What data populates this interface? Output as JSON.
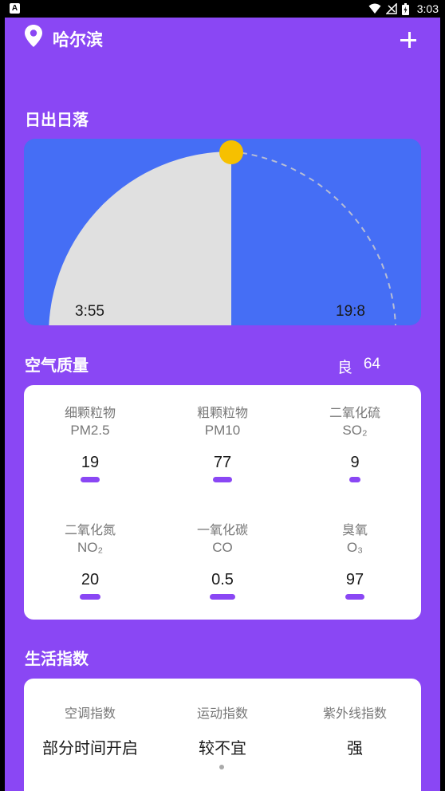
{
  "status_bar": {
    "app_icon_label": "A",
    "time": "3:03"
  },
  "header": {
    "city": "哈尔滨",
    "add_icon": "plus-icon",
    "location_icon": "location-pin-icon"
  },
  "sunrise_sunset": {
    "title": "日出日落",
    "sunrise": "3:55",
    "sunset": "19:8",
    "colors": {
      "sky": "#456ef5",
      "elapsed": "#e0e0e0",
      "sun": "#f6c000"
    }
  },
  "air_quality": {
    "title": "空气质量",
    "level": "良",
    "index": "64",
    "items": [
      {
        "name": "细颗粒物",
        "code": "PM2.5",
        "value": "19"
      },
      {
        "name": "粗颗粒物",
        "code": "PM10",
        "value": "77"
      },
      {
        "name": "二氧化硫",
        "code": "SO₂",
        "value": "9"
      },
      {
        "name": "二氧化氮",
        "code": "NO₂",
        "value": "20"
      },
      {
        "name": "一氧化碳",
        "code": "CO",
        "value": "0.5"
      },
      {
        "name": "臭氧",
        "code": "O₃",
        "value": "97"
      }
    ]
  },
  "life_index": {
    "title": "生活指数",
    "items": [
      {
        "name": "空调指数",
        "value": "部分时间开启"
      },
      {
        "name": "运动指数",
        "value": "较不宜"
      },
      {
        "name": "紫外线指数",
        "value": "强"
      }
    ]
  },
  "theme": {
    "background": "#8a47f4",
    "accent_bar": "#8a47f4"
  }
}
